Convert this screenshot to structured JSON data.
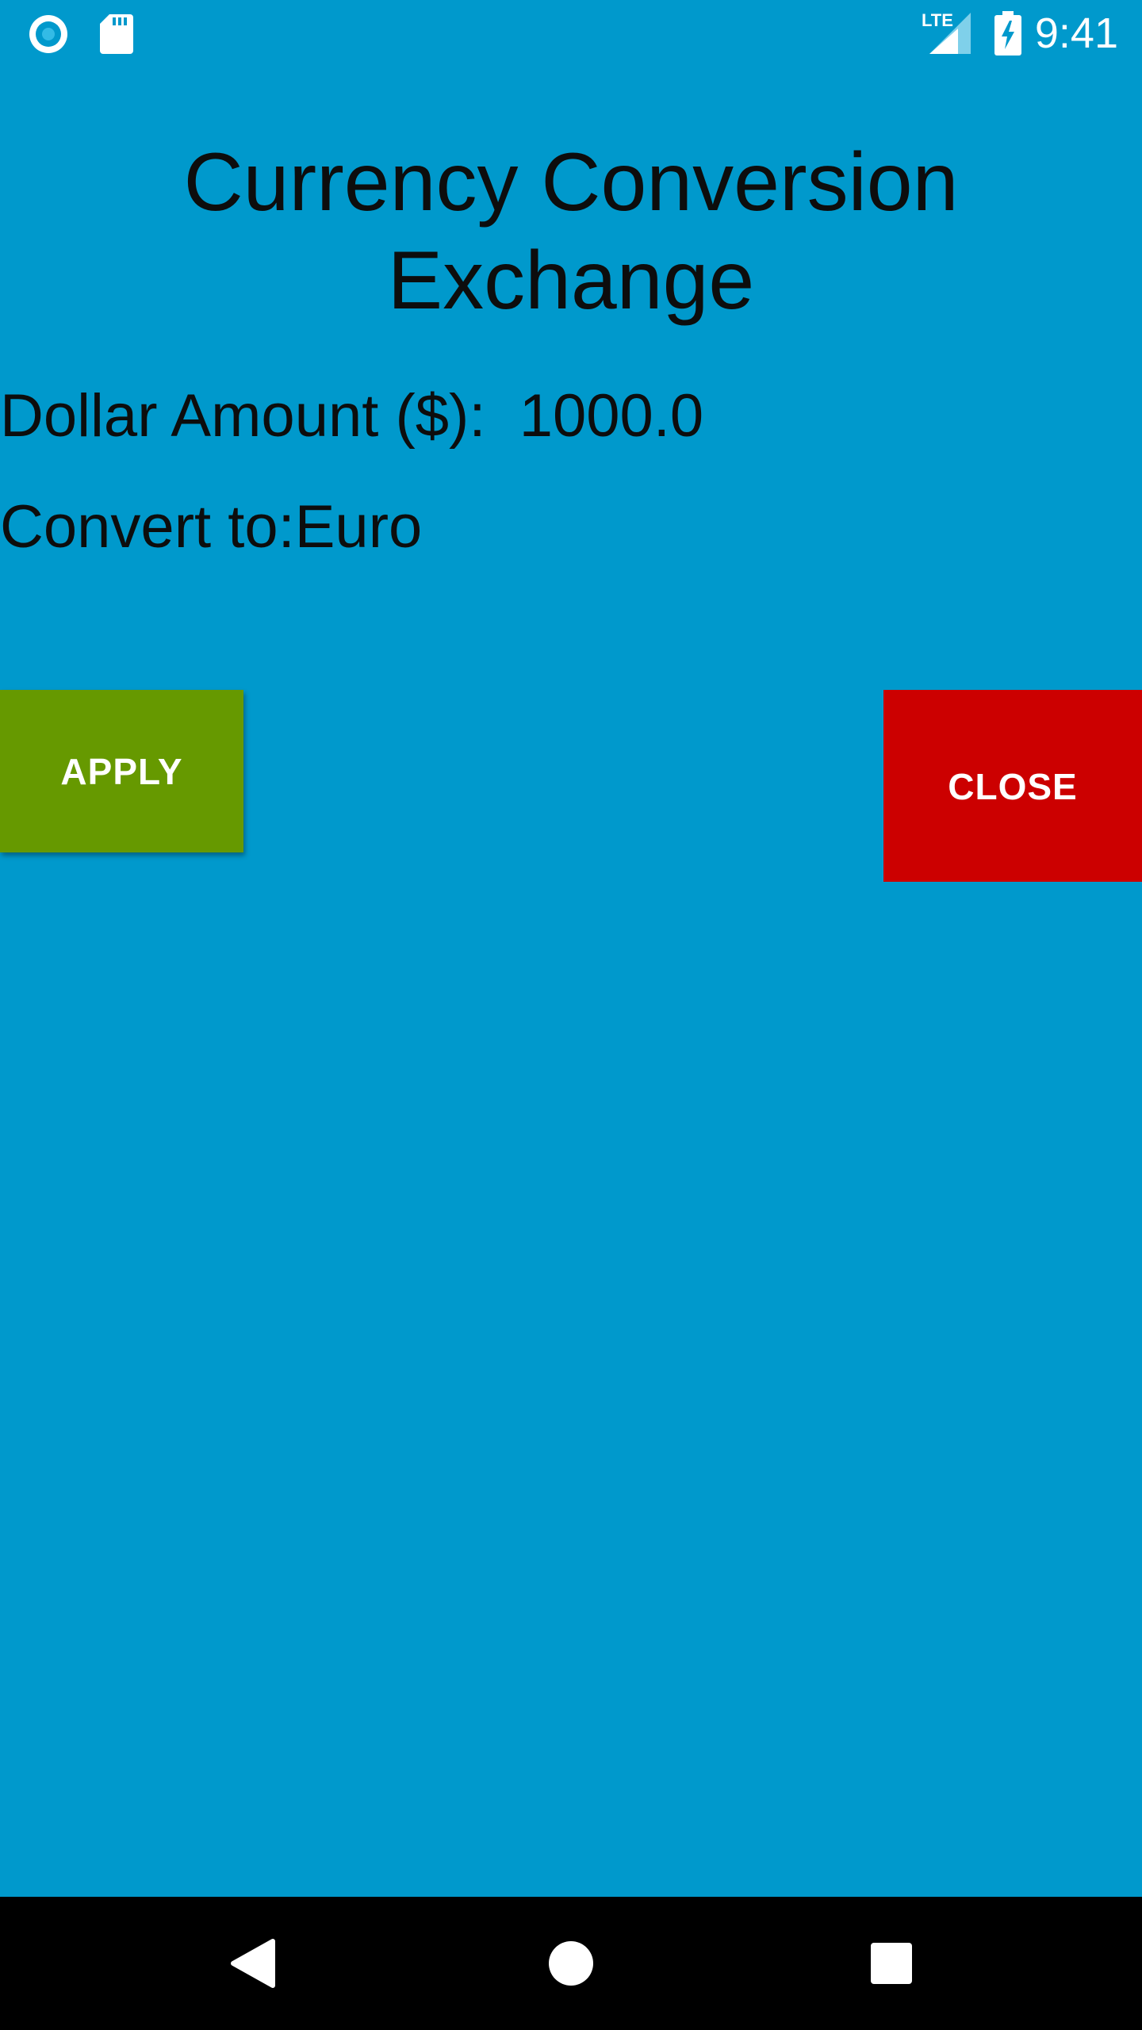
{
  "status_bar": {
    "time": "9:41",
    "network_label": "LTE",
    "icons": [
      "record-icon",
      "sd-card-icon",
      "lte-signal-icon",
      "battery-charging-icon"
    ]
  },
  "screen": {
    "title": "Currency Conversion Exchange",
    "amount_label": "Dollar Amount ($):",
    "amount_value": "1000.0",
    "convert_label": "Convert to:",
    "convert_value": "Euro"
  },
  "buttons": {
    "apply_label": "APPLY",
    "close_label": "CLOSE"
  },
  "nav_bar": {
    "icons": [
      "back-icon",
      "home-icon",
      "recents-icon"
    ]
  },
  "colors": {
    "background": "#0099cc",
    "apply_button": "#669900",
    "close_button": "#cc0000",
    "nav_bar": "#000000",
    "text": "#0d0d0d"
  }
}
